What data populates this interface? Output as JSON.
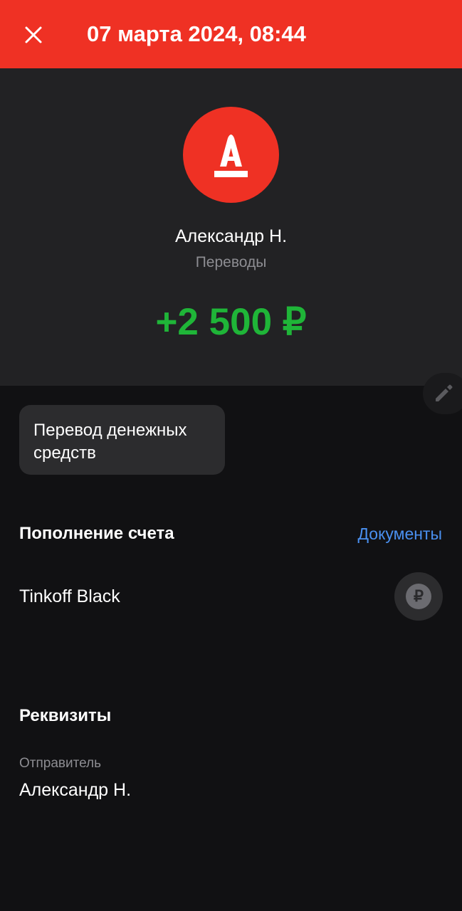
{
  "header": {
    "title": "07 марта 2024, 08:44",
    "close_icon": "close-icon",
    "accent_color": "#ef3124"
  },
  "transaction": {
    "bank_logo_letter": "А",
    "counterparty": "Александр Н.",
    "category": "Переводы",
    "amount": "+2 500 ₽",
    "amount_color": "#1fb538",
    "comment": "Перевод денежных средств",
    "edit_icon": "pencil-icon"
  },
  "account_section": {
    "title": "Пополнение счета",
    "documents_link": "Документы",
    "account_name": "Tinkoff Black",
    "account_icon": "ruble-icon",
    "account_icon_glyph": "₽"
  },
  "details": {
    "title": "Реквизиты",
    "sender_label": "Отправитель",
    "sender_value": "Александр Н."
  }
}
